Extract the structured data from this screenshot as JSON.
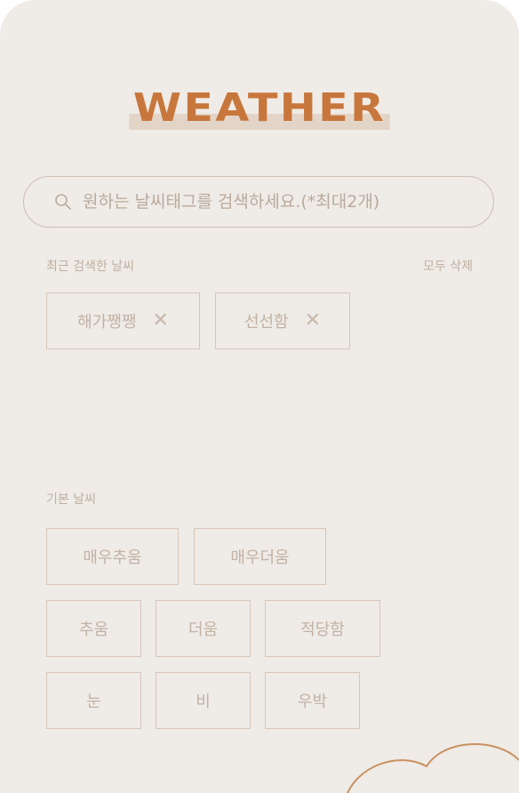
{
  "header": {
    "logo_text": "WEATHER"
  },
  "search": {
    "placeholder": "원하는 날씨태그를 검색하세요.(*최대2개)",
    "icon": "search-icon"
  },
  "recent": {
    "label": "최근 검색한 날씨",
    "clear_all_label": "모두 삭제",
    "tags": [
      {
        "label": "해가쨍쨍",
        "remove_icon": "close-icon"
      },
      {
        "label": "선선함",
        "remove_icon": "close-icon"
      }
    ]
  },
  "basic": {
    "label": "기본 날씨",
    "tags": [
      {
        "label": "매우추움"
      },
      {
        "label": "매우더움"
      },
      {
        "label": "추움"
      },
      {
        "label": "더움"
      },
      {
        "label": "적당함"
      },
      {
        "label": "눈"
      },
      {
        "label": "비"
      },
      {
        "label": "우박"
      }
    ]
  },
  "colors": {
    "accent": "#c8773c",
    "background": "#efebe6",
    "tag_border": "#d6c6b8"
  }
}
